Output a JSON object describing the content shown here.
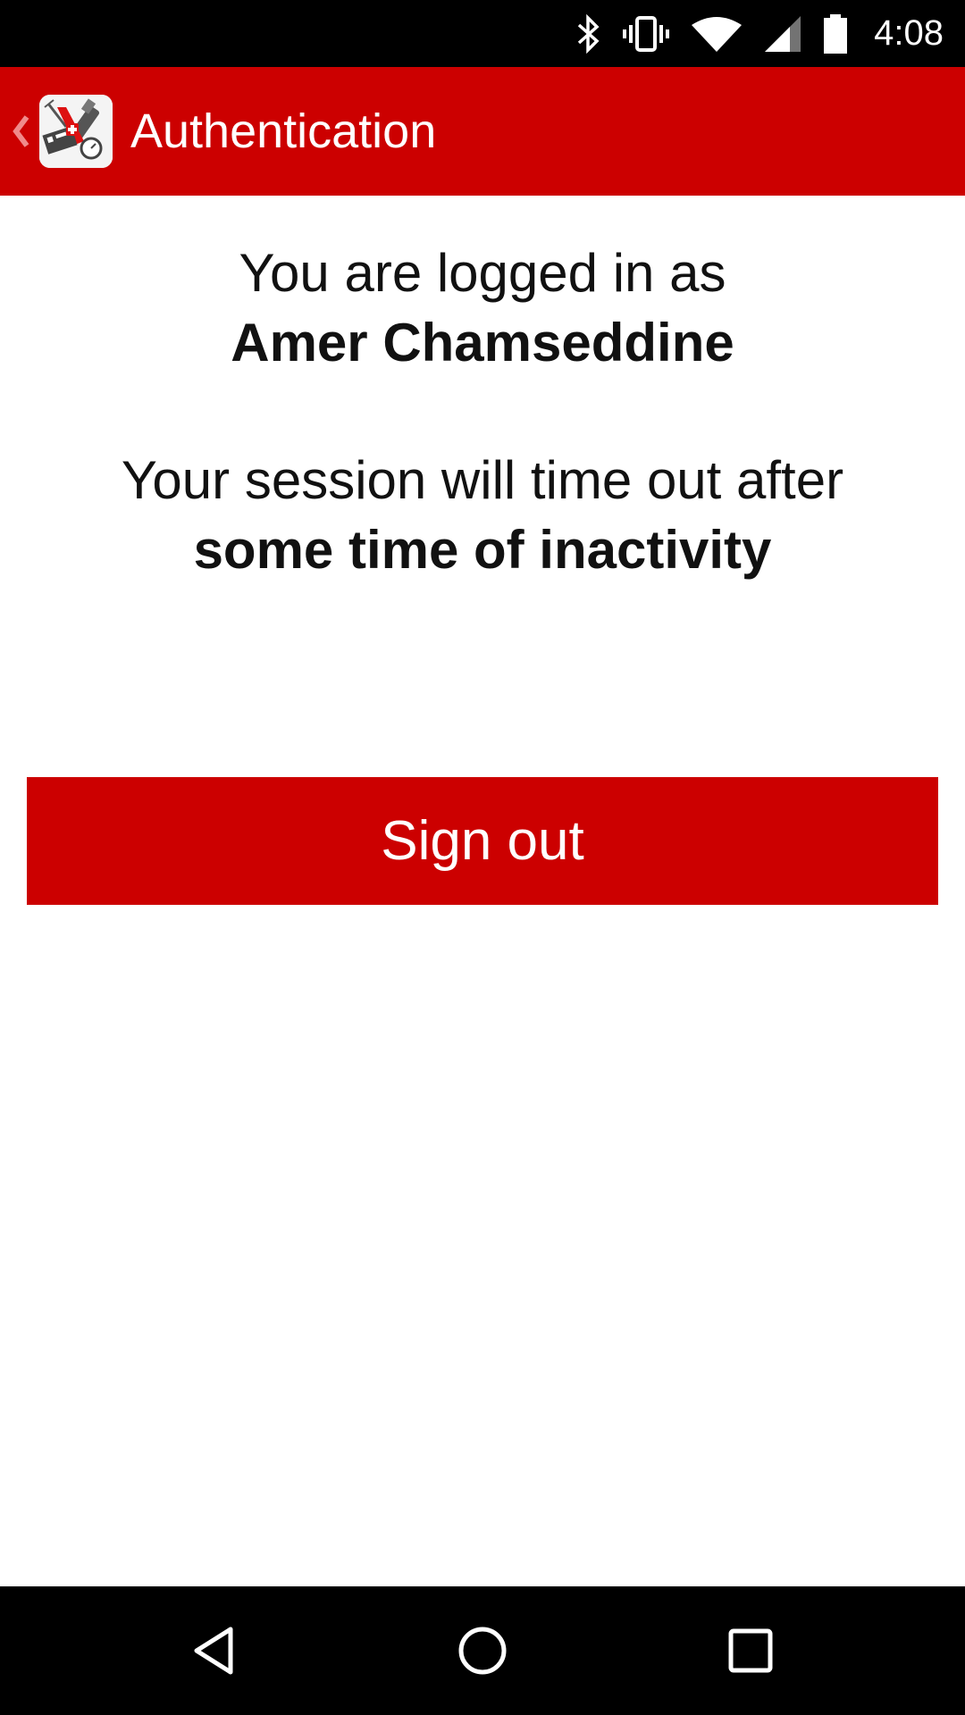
{
  "status_bar": {
    "time": "4:08",
    "icons": [
      "bluetooth-icon",
      "vibrate-icon",
      "wifi-icon",
      "cell-signal-icon",
      "battery-icon"
    ]
  },
  "app_bar": {
    "title": "Authentication",
    "back_icon": "chevron-left-icon",
    "logo_icon": "swiss-army-knife-app-logo",
    "background_color": "#cc0000"
  },
  "content": {
    "logged_in_prefix": "You are logged in as",
    "user_name": "Amer Chamseddine",
    "session_prefix": "Your session will time out after",
    "session_timeout": "some time of inactivity"
  },
  "actions": {
    "sign_out_label": "Sign out",
    "button_color": "#cc0000"
  },
  "nav_bar": {
    "items": [
      "back-icon",
      "home-icon",
      "recents-icon"
    ]
  }
}
